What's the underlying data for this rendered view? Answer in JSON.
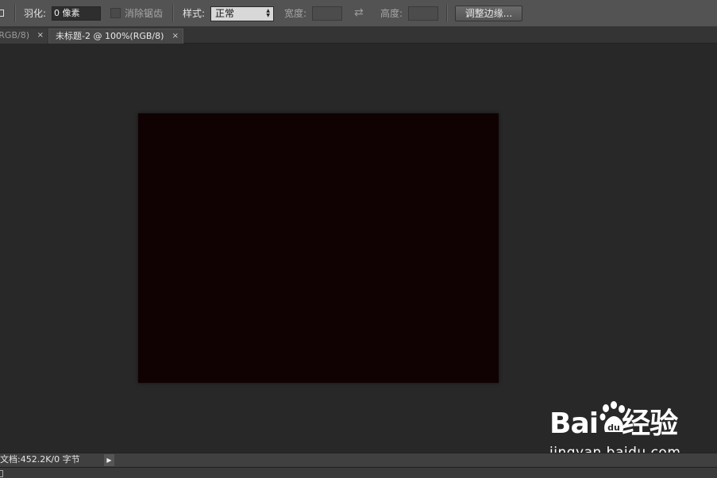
{
  "options_bar": {
    "feather_label": "羽化:",
    "feather_value": "0 像素",
    "antialias_label": "消除锯齿",
    "style_label": "样式:",
    "style_value": "正常",
    "width_label": "宽度:",
    "height_label": "高度:",
    "refine_edge_label": "调整边缘..."
  },
  "tabs": [
    {
      "label": "(RGB/8)",
      "close": "×",
      "active": false
    },
    {
      "label": "未标题-2 @ 100%(RGB/8)",
      "close": "×",
      "active": true
    }
  ],
  "canvas": {
    "fill_color": "#100202"
  },
  "status_bar": {
    "doc_info": "文档:452.2K/0 字节",
    "arrow": "▶"
  },
  "watermark": {
    "logo_text": "Bai",
    "logo_suffix": "经验",
    "url": "jingyan.baidu.com"
  }
}
